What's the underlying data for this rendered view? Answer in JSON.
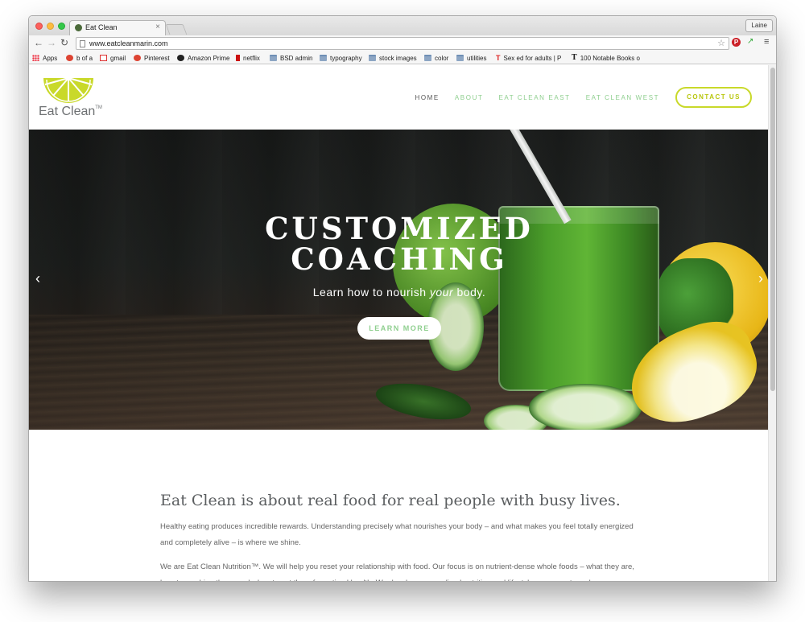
{
  "browser": {
    "tab_title": "Eat Clean",
    "tab_close": "×",
    "profile": "Laine",
    "url": "www.eatcleanmarin.com",
    "nav_back": "←",
    "nav_forward": "→",
    "nav_reload": "↻",
    "star": "☆",
    "pin_ext": "P",
    "ext_arrow": "↗",
    "menu": "≡"
  },
  "bookmarks": [
    {
      "label": "Apps",
      "icon": "apps-icon"
    },
    {
      "label": "b of a",
      "icon": "bank-icon"
    },
    {
      "label": "gmail",
      "icon": "gmail-icon"
    },
    {
      "label": "Pinterest",
      "icon": "pinterest-icon"
    },
    {
      "label": "Amazon Prime",
      "icon": "amazon-icon"
    },
    {
      "label": "netflix",
      "icon": "netflix-icon"
    },
    {
      "label": "BSD admin",
      "icon": "folder-icon"
    },
    {
      "label": "typography",
      "icon": "folder-icon"
    },
    {
      "label": "stock images",
      "icon": "folder-icon"
    },
    {
      "label": "color",
      "icon": "folder-icon"
    },
    {
      "label": "utilities",
      "icon": "folder-icon"
    },
    {
      "label": "Sex ed for adults | P",
      "icon": "t-icon"
    },
    {
      "label": "100 Notable Books o",
      "icon": "nyt-icon"
    }
  ],
  "site": {
    "logo_text": "Eat Clean",
    "logo_tm": "TM",
    "nav": {
      "home": "HOME",
      "about": "ABOUT",
      "east": "EAT CLEAN EAST",
      "west": "EAT CLEAN WEST",
      "contact": "CONTACT US"
    },
    "hero": {
      "title_line1": "CUSTOMIZED",
      "title_line2": "COACHING",
      "subtitle_pre": "Learn how to nourish ",
      "subtitle_em": "your",
      "subtitle_post": " body.",
      "button": "LEARN MORE",
      "prev": "‹",
      "next": "›"
    },
    "intro": {
      "heading": "Eat Clean is about real food for real people with busy lives.",
      "p1": "Healthy eating produces incredible rewards.  Understanding precisely what nourishes your body – and what makes you feel totally energized and completely alive – is where we shine.",
      "p2": "We are Eat Clean Nutrition™.  We will help you reset your relationship with food.  Our focus is on nutrient-dense whole foods – what they are, how to combine them, and when to eat them for optimal health.  We develop personalized nutrition and lifestyle programs to make"
    }
  },
  "colors": {
    "accent_green": "#8fcf8f",
    "accent_lime": "#c9d92a",
    "text_gray": "#5b5e60"
  }
}
